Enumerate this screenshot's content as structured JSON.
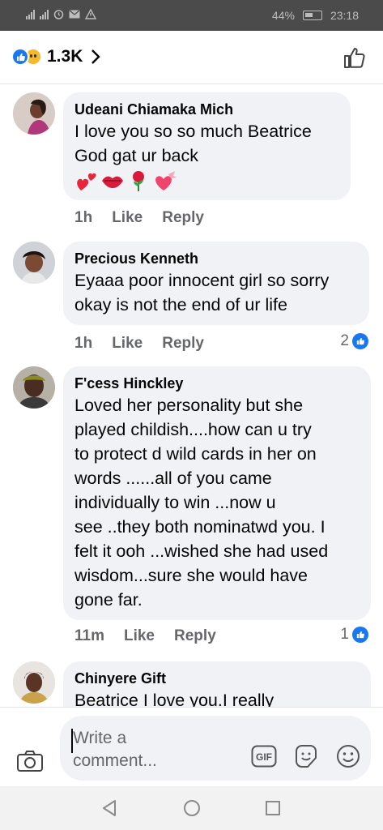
{
  "status_bar": {
    "battery": "44%",
    "time": "23:18"
  },
  "header": {
    "reaction_count": "1.3K"
  },
  "comments": [
    {
      "author": "Udeani Chiamaka Mich",
      "lines": [
        "I love you so so much Beatrice",
        "God gat ur back"
      ],
      "emojis": [
        "sparkling-hearts",
        "kiss-lips",
        "rose",
        "heart-with-ribbon"
      ],
      "time": "1h",
      "like": "Like",
      "reply": "Reply",
      "reactions": ""
    },
    {
      "author": "Precious Kenneth",
      "lines": [
        "Eyaaa poor innocent girl so sorry",
        "okay is not the end of ur life"
      ],
      "time": "1h",
      "like": "Like",
      "reply": "Reply",
      "reactions": "2"
    },
    {
      "author": "F'cess Hinckley",
      "lines": [
        "Loved her personality but she",
        "played childish....how can u try",
        "to protect d wild cards in her on",
        "words ......all of you came",
        "individually to win ...now u",
        "see ..they both nominatwd you. I",
        "felt it ooh ...wished she had used",
        "wisdom...sure she would have",
        "gone far."
      ],
      "time": "11m",
      "like": "Like",
      "reply": "Reply",
      "reactions": "1"
    },
    {
      "author": "Chinyere Gift",
      "lines": [
        "Beatrice I love you.I really"
      ]
    }
  ],
  "composer": {
    "placeholder_line1": "Write a",
    "placeholder_line2": "comment..."
  }
}
